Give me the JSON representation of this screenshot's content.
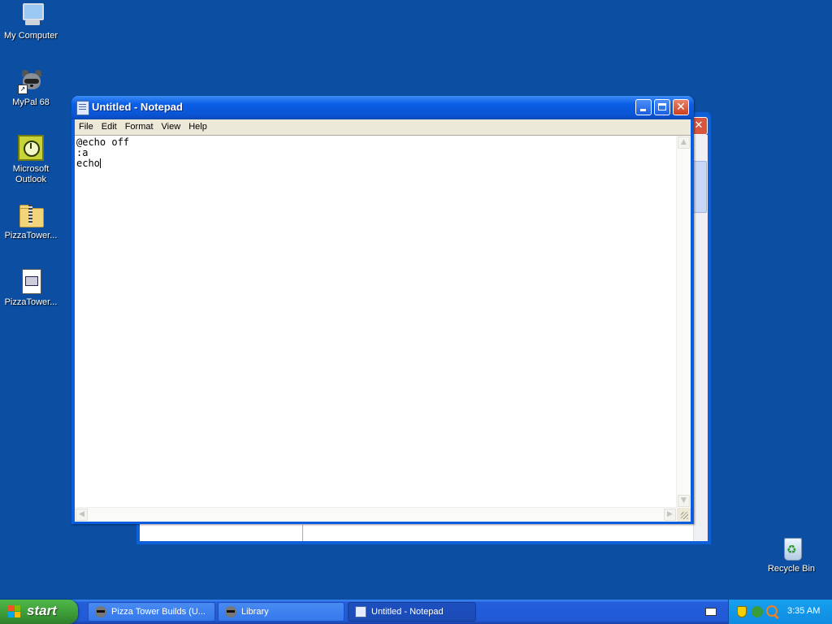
{
  "desktop": {
    "icons": [
      {
        "label": "My Computer",
        "icon": "computer-icon"
      },
      {
        "label": "MyPal 68",
        "icon": "raccoon-icon"
      },
      {
        "label": "Microsoft\nOutlook",
        "icon": "outlook-icon"
      },
      {
        "label": "PizzaTower...",
        "icon": "zip-folder-icon"
      },
      {
        "label": "PizzaTower...",
        "icon": "document-icon"
      },
      {
        "label": "Recycle Bin",
        "icon": "recycle-bin-icon"
      }
    ]
  },
  "notepad": {
    "title": "Untitled - Notepad",
    "menu": [
      "File",
      "Edit",
      "Format",
      "View",
      "Help"
    ],
    "content_lines": [
      "@echo off",
      ":a",
      "echo"
    ]
  },
  "taskbar": {
    "start_label": "start",
    "tasks": [
      {
        "label": "Pizza Tower Builds (U...",
        "icon": "raccoon-icon",
        "active": false
      },
      {
        "label": "Library",
        "icon": "raccoon-icon",
        "active": false
      },
      {
        "label": "Untitled - Notepad",
        "icon": "notepad-icon",
        "active": true
      }
    ],
    "clock": "3:35 AM"
  },
  "colors": {
    "desktop": "#0b4ea2",
    "titlebar": "#0a5ee6",
    "start": "#3c9a37",
    "tray": "#0f8be0"
  }
}
